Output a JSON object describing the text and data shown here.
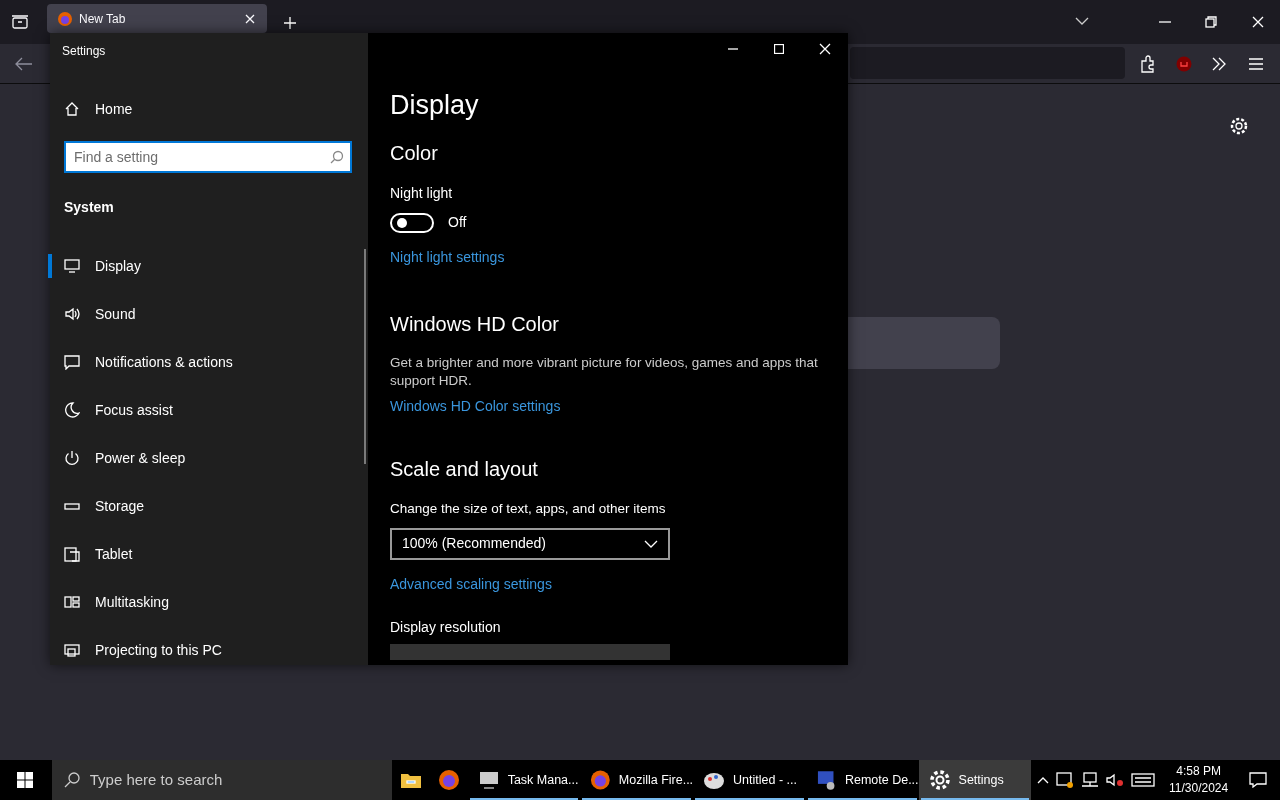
{
  "browser": {
    "tabs": [
      {
        "label": "New Tab",
        "selected": true
      }
    ]
  },
  "settings_window": {
    "title": "Settings",
    "home": "Home",
    "search": {
      "placeholder": "Find a setting"
    },
    "group": "System",
    "nav": [
      {
        "label": "Display",
        "selected": true
      },
      {
        "label": "Sound",
        "selected": false
      },
      {
        "label": "Notifications & actions",
        "selected": false
      },
      {
        "label": "Focus assist",
        "selected": false
      },
      {
        "label": "Power & sleep",
        "selected": false
      },
      {
        "label": "Storage",
        "selected": false
      },
      {
        "label": "Tablet",
        "selected": false
      },
      {
        "label": "Multitasking",
        "selected": false
      },
      {
        "label": "Projecting to this PC",
        "selected": false
      }
    ],
    "page_title": "Display",
    "color": {
      "heading": "Color",
      "night_light": {
        "label": "Night light",
        "on": false,
        "state": "Off"
      },
      "link": "Night light settings"
    },
    "hd_color": {
      "heading": "Windows HD Color",
      "text": "Get a brighter and more vibrant picture for videos, games and apps that support HDR.",
      "link": "Windows HD Color settings"
    },
    "scale": {
      "heading": "Scale and layout",
      "label": "Change the size of text, apps, and other items",
      "value": "100% (Recommended)",
      "link": "Advanced scaling settings",
      "resolution_label": "Display resolution"
    }
  },
  "taskbar": {
    "search": {
      "placeholder": "Type here to search"
    },
    "apps": [
      {
        "label": "Task Mana...",
        "running": true,
        "selected": false
      },
      {
        "label": "Mozilla Fire...",
        "running": true,
        "selected": false
      },
      {
        "label": "Untitled - ...",
        "running": true,
        "selected": false
      },
      {
        "label": "Remote De...",
        "running": true,
        "selected": false
      },
      {
        "label": "Settings",
        "running": true,
        "selected": true
      }
    ],
    "time": "4:58 PM",
    "date": "11/30/2024"
  }
}
